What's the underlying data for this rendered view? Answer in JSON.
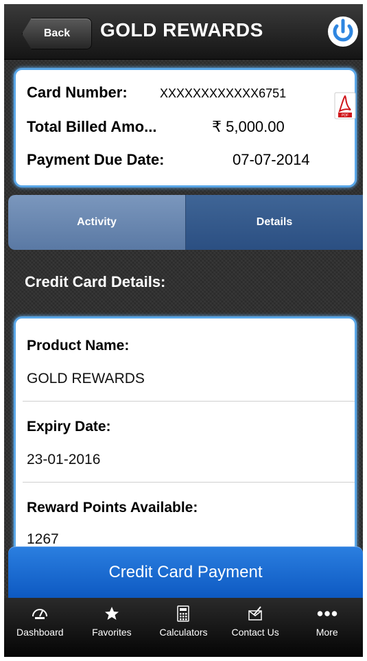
{
  "header": {
    "back_label": "Back",
    "title": "GOLD REWARDS"
  },
  "summary": {
    "card_number_label": "Card Number:",
    "card_number_value": "XXXXXXXXXXXX6751",
    "total_billed_label": "Total Billed Amo...",
    "total_billed_value": "₹ 5,000.00",
    "due_date_label": "Payment Due Date:",
    "due_date_value": "07-07-2014"
  },
  "tabs": [
    {
      "label": "Activity",
      "selected": false
    },
    {
      "label": "Details",
      "selected": true
    }
  ],
  "section_title": "Credit Card Details:",
  "details": {
    "product_label": "Product Name:",
    "product_value": "GOLD REWARDS",
    "expiry_label": "Expiry Date:",
    "expiry_value": "23-01-2016",
    "reward_label": "Reward Points Available:",
    "reward_value": "1267"
  },
  "payment_button": "Credit Card Payment",
  "tabbar": [
    {
      "label": "Dashboard",
      "icon": "dashboard-icon"
    },
    {
      "label": "Favorites",
      "icon": "star-icon"
    },
    {
      "label": "Calculators",
      "icon": "calculator-icon"
    },
    {
      "label": "Contact Us",
      "icon": "contact-icon"
    },
    {
      "label": "More",
      "icon": "more-icon"
    }
  ],
  "colors": {
    "accent_blue": "#1a6ad6",
    "card_border": "#5aa7e8",
    "tab_selected": "#2b4f82"
  }
}
